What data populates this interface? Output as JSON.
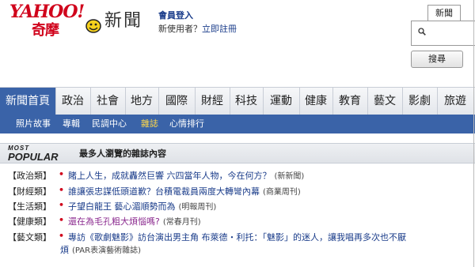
{
  "header": {
    "logo_top": "YAHOO!",
    "logo_bottom": "奇摩",
    "section_title": "新聞",
    "member_login": "會員登入",
    "new_user_prefix": "新使用者？",
    "register_link": "立即註冊",
    "news_tab": "新聞",
    "search_button": "搜尋",
    "search_placeholder": ""
  },
  "nav": {
    "items": [
      {
        "label": "新聞首頁",
        "active": true
      },
      {
        "label": "政治"
      },
      {
        "label": "社會"
      },
      {
        "label": "地方"
      },
      {
        "label": "國際"
      },
      {
        "label": "財經"
      },
      {
        "label": "科技"
      },
      {
        "label": "運動"
      },
      {
        "label": "健康"
      },
      {
        "label": "教育"
      },
      {
        "label": "藝文"
      },
      {
        "label": "影劇"
      },
      {
        "label": "旅遊"
      }
    ]
  },
  "subnav": {
    "items": [
      {
        "label": "照片故事"
      },
      {
        "label": "專輯"
      },
      {
        "label": "民調中心"
      },
      {
        "label": "雜誌",
        "active": true
      },
      {
        "label": "心情排行"
      }
    ]
  },
  "most_popular": {
    "badge_top": "MOST",
    "badge_bottom": "POPULAR",
    "heading": "最多人瀏覽的雜誌內容"
  },
  "articles": [
    {
      "category": "【政治類】",
      "title": "賭上人生，成就轟然巨響 六四當年人物，今在何方？",
      "source": "(新新聞)"
    },
    {
      "category": "【財經類】",
      "title": "誰讓張忠謀低頭道歉？台積電裁員兩度大轉彎內幕",
      "source": "(商業周刊)"
    },
    {
      "category": "【生活類】",
      "title": "子望白龍王 藝心湄順勢而為",
      "source": "(明報周刊)"
    },
    {
      "category": "【健康類】",
      "title": "還在為毛孔粗大煩惱嗎?",
      "source": "(常春月刊)"
    },
    {
      "category": "【藝文類】",
      "title": "專訪《歌劇魅影》訪台演出男主角 布萊德・利托：「魅影」的迷人，讓我唱再多次也不厭",
      "title_line2": "煩",
      "source": "(PAR表演藝術雜誌)"
    }
  ],
  "colors": {
    "brand_red": "#d0021b",
    "nav_blue": "#3a63a8",
    "link_blue": "#1a3c8a",
    "visited_purple": "#8b2a8f",
    "subnav_active": "#ffd84a"
  },
  "icons": {
    "search": "search-icon",
    "logo_smile": "smile-icon"
  }
}
